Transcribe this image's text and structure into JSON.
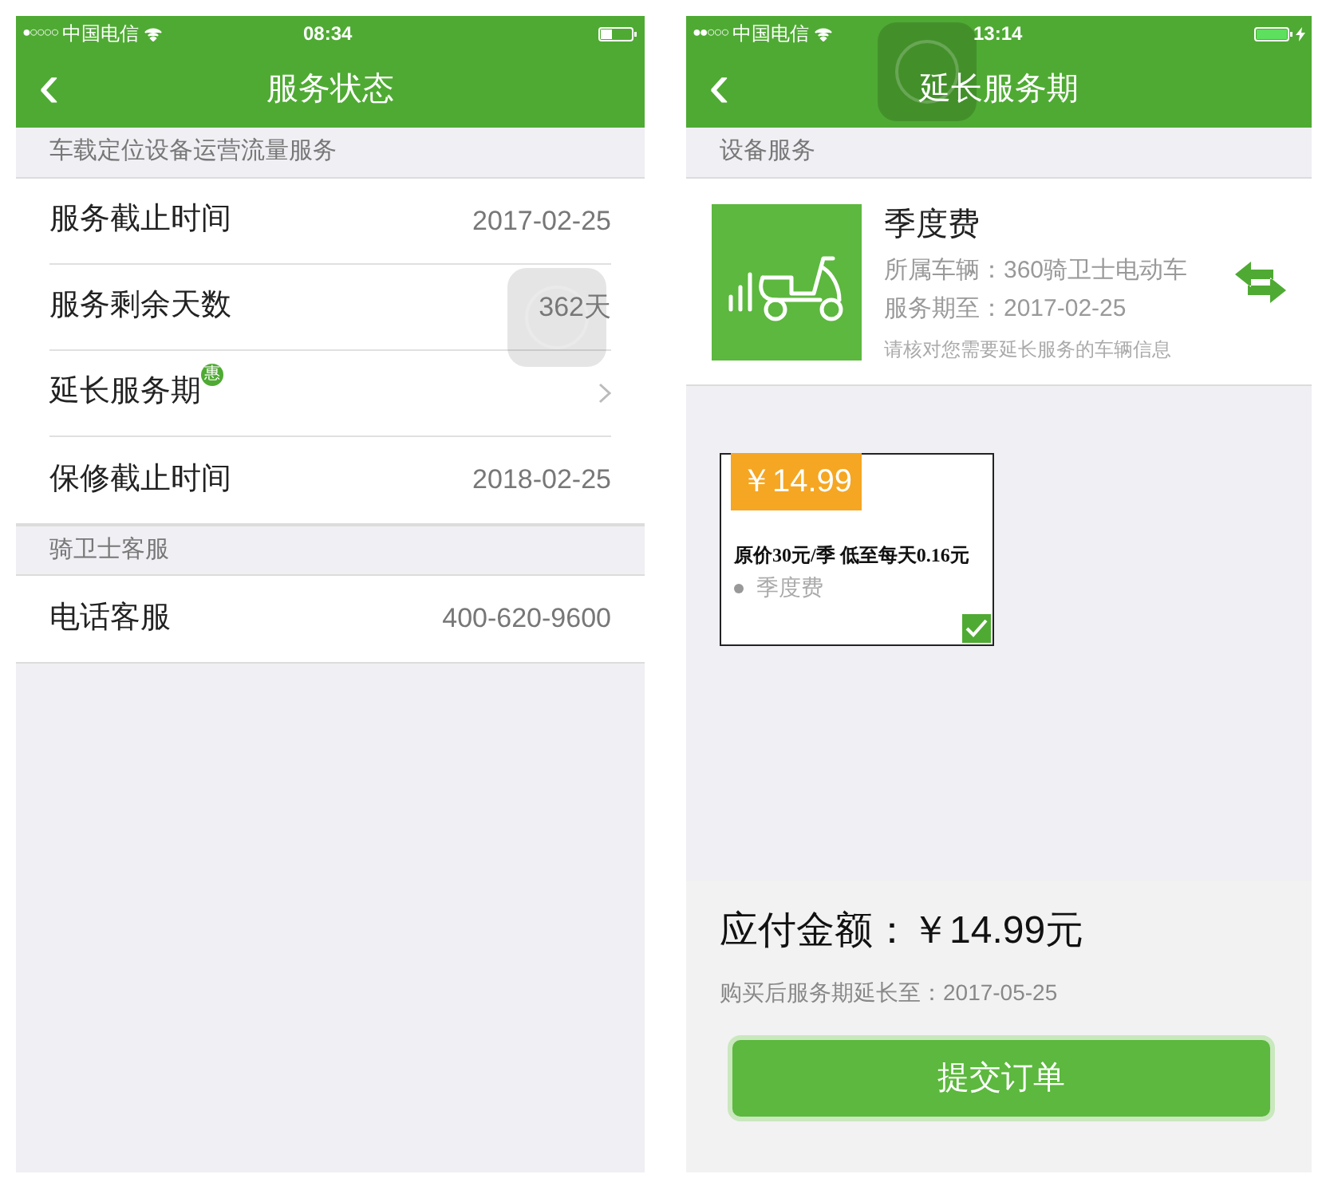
{
  "screens": [
    {
      "status_bar": {
        "signal_dots": "●○○○○",
        "carrier": "中国电信",
        "time": "08:34"
      },
      "nav": {
        "back": "‹",
        "title": "服务状态"
      },
      "sections": [
        {
          "header": "车载定位设备运营流量服务",
          "rows": [
            {
              "kind": "value",
              "label": "服务截止时间",
              "value": "2017-02-25"
            },
            {
              "kind": "value",
              "label": "服务剩余天数",
              "value": "362天"
            },
            {
              "kind": "link",
              "label": "延长服务期",
              "badge": "惠"
            },
            {
              "kind": "value",
              "label": "保修截止时间",
              "value": "2018-02-25"
            }
          ]
        },
        {
          "header": "骑卫士客服",
          "rows": [
            {
              "kind": "value",
              "label": "电话客服",
              "value": "400-620-9600"
            }
          ]
        }
      ]
    },
    {
      "status_bar": {
        "signal_dots": "●●○○○",
        "carrier": "中国电信",
        "time": "13:14"
      },
      "nav": {
        "back": "‹",
        "title": "延长服务期"
      },
      "section_header": "设备服务",
      "device": {
        "title": "季度费",
        "vehicle": "所属车辆：360骑卫士电动车",
        "expiry": "服务期至：2017-02-25",
        "hint": "请核对您需要延长服务的车辆信息"
      },
      "plans": [
        {
          "price": "￥14.99",
          "description": "原价30元/季 低至每天0.16元",
          "name": "季度费",
          "selected": true
        }
      ],
      "summary": {
        "amount": "应付金额：￥14.99元",
        "extended_to": "购买后服务期延长至：2017-05-25"
      },
      "submit": "提交订单"
    }
  ]
}
